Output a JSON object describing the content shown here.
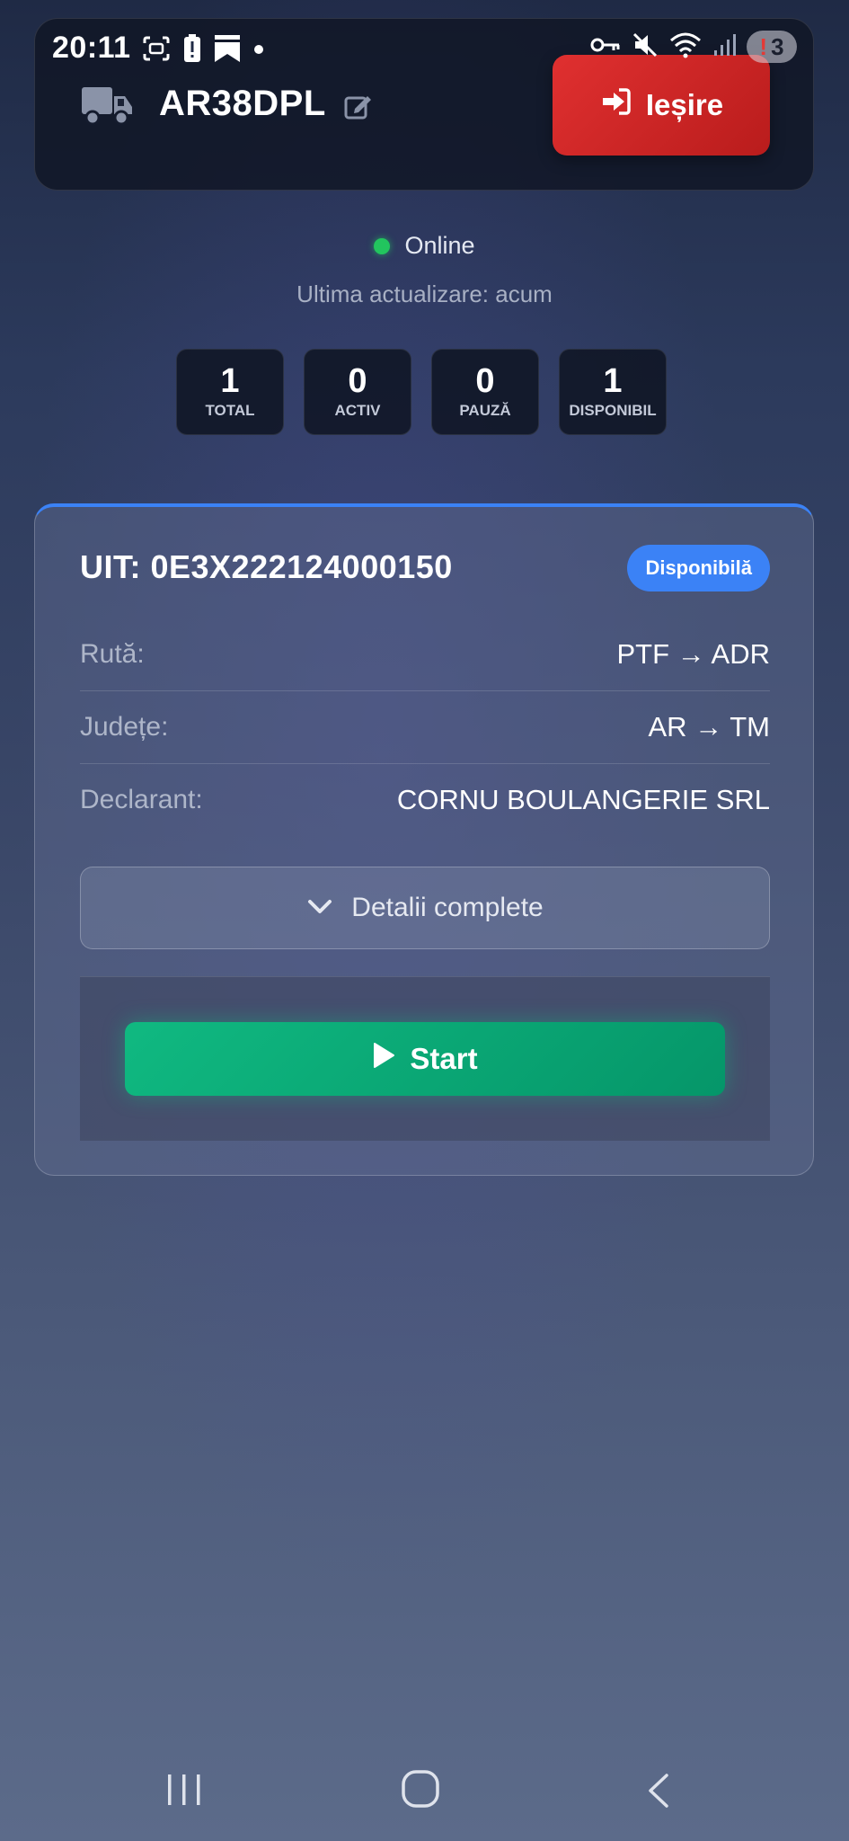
{
  "status_bar": {
    "time": "20:11",
    "notification_count": "3",
    "left_icons": [
      "screenshot-icon",
      "battery-alert-icon",
      "bookmark-icon",
      "dot-icon"
    ],
    "right_icons": [
      "key-icon",
      "mute-icon",
      "wifi-icon",
      "signal-icon"
    ]
  },
  "header": {
    "plate": "AR38DPL",
    "exit_label": "Ieșire"
  },
  "status": {
    "online_label": "Online",
    "last_update": "Ultima actualizare: acum",
    "online_color": "#22c55e"
  },
  "stats": [
    {
      "value": "1",
      "label": "TOTAL"
    },
    {
      "value": "0",
      "label": "ACTIV"
    },
    {
      "value": "0",
      "label": "PAUZĂ"
    },
    {
      "value": "1",
      "label": "DISPONIBIL"
    }
  ],
  "transport": {
    "uit": "UIT: 0E3X222124000150",
    "status_badge": "Disponibilă",
    "rows": [
      {
        "label": "Rută:",
        "value": "PTF → ADR"
      },
      {
        "label": "Județe:",
        "value": "AR → TM"
      },
      {
        "label": "Declarant:",
        "value": "CORNU BOULANGERIE SRL"
      }
    ],
    "details_label": "Detalii complete",
    "start_label": "Start"
  },
  "colors": {
    "accent_blue": "#3b82f6",
    "exit_red": "#dc2626",
    "start_green": "#10b981"
  }
}
